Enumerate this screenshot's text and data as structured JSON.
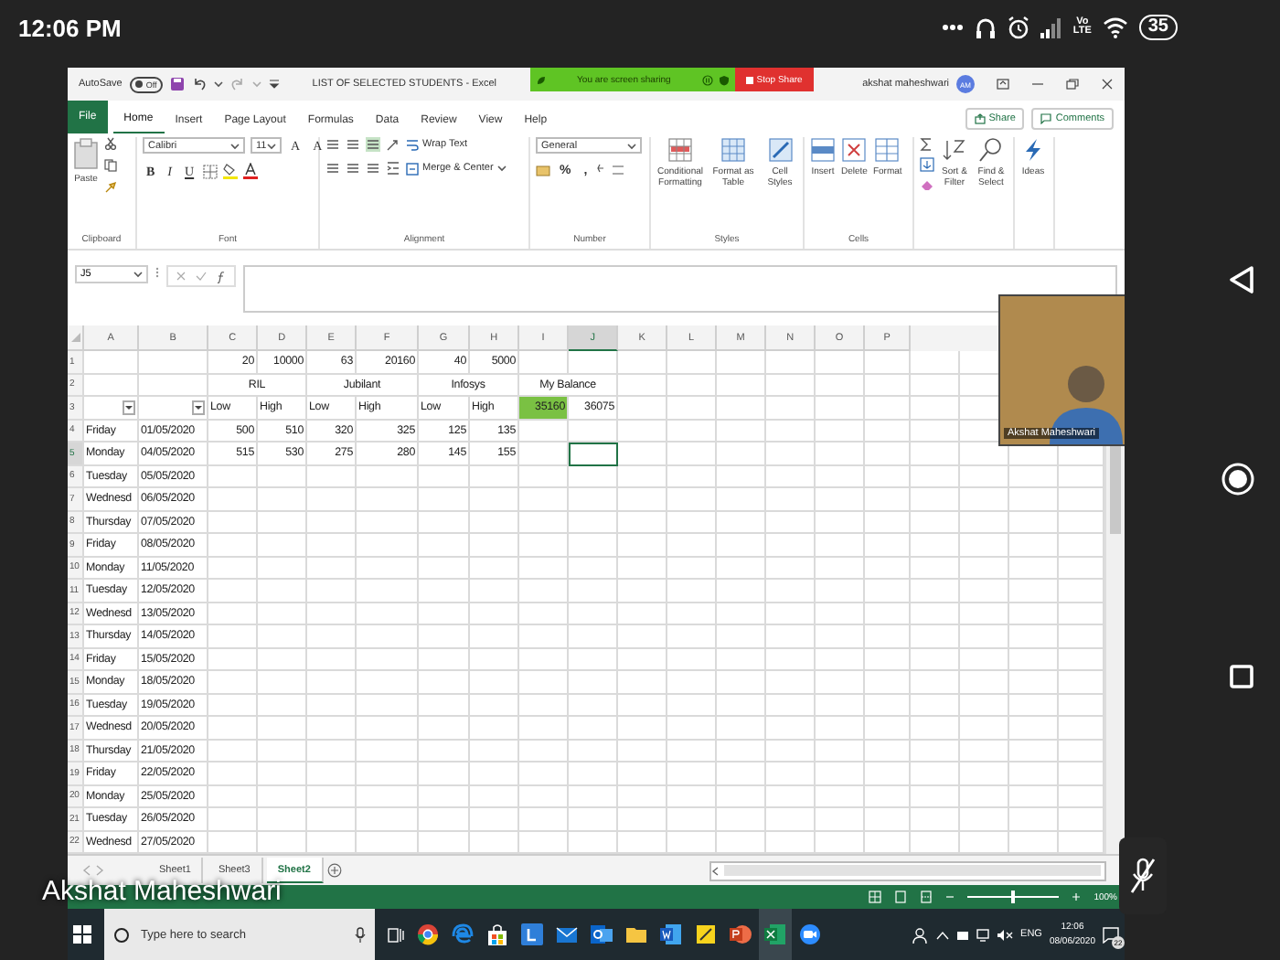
{
  "phone_status": {
    "time": "12:06 PM",
    "network": [
      "Vo",
      "LTE"
    ],
    "battery": "35"
  },
  "window": {
    "autosave_label": "AutoSave",
    "autosave_state": "Off",
    "autosave_on": false,
    "title": "LIST OF SELECTED STUDENTS  -  Excel",
    "user": "akshat maheshwari",
    "avatar": "AM"
  },
  "share_banner": {
    "message": "You are screen sharing",
    "stop": "Stop Share"
  },
  "ribbon_tabs": [
    {
      "label": "File",
      "kind": "file",
      "selected": false
    },
    {
      "label": "Home",
      "kind": "tab",
      "selected": true
    },
    {
      "label": "Insert",
      "kind": "tab",
      "selected": false
    },
    {
      "label": "Page Layout",
      "kind": "tab",
      "selected": false
    },
    {
      "label": "Formulas",
      "kind": "tab",
      "selected": false
    },
    {
      "label": "Data",
      "kind": "tab",
      "selected": false
    },
    {
      "label": "Review",
      "kind": "tab",
      "selected": false
    },
    {
      "label": "View",
      "kind": "tab",
      "selected": false
    },
    {
      "label": "Help",
      "kind": "tab",
      "selected": false
    }
  ],
  "ribbon_actions": {
    "share": "Share",
    "comments": "Comments"
  },
  "ribbon": [
    {
      "kind": "clipboard",
      "label": "Clipboard",
      "buttons": [
        "Paste"
      ]
    },
    {
      "kind": "font",
      "label": "Font",
      "font": "Calibri",
      "size": "11",
      "size_buttons": [
        "A",
        "A"
      ],
      "styles": [
        "B",
        "I",
        "U"
      ]
    },
    {
      "kind": "alignment",
      "label": "Alignment",
      "buttons": [
        "Wrap Text",
        "Merge & Center"
      ]
    },
    {
      "kind": "number",
      "label": "Number",
      "format": "General",
      "symbols": [
        "%",
        ","
      ]
    },
    {
      "kind": "styles",
      "label": "Styles",
      "buttons": [
        "Conditional Formatting",
        "Format as Table",
        "Cell Styles"
      ]
    },
    {
      "kind": "cells",
      "label": "Cells",
      "buttons": [
        "Insert",
        "Delete",
        "Format"
      ]
    },
    {
      "kind": "editing",
      "buttons": [
        "Sort & Filter",
        "Find & Select"
      ]
    },
    {
      "kind": "ideas",
      "buttons": [
        "Ideas"
      ]
    }
  ],
  "formula_bar": {
    "name_box": "J5"
  },
  "columns": [
    {
      "label": "A",
      "selected": false
    },
    {
      "label": "B",
      "selected": false
    },
    {
      "label": "C",
      "selected": false
    },
    {
      "label": "D",
      "selected": false
    },
    {
      "label": "E",
      "selected": false
    },
    {
      "label": "F",
      "selected": false
    },
    {
      "label": "G",
      "selected": false
    },
    {
      "label": "H",
      "selected": false
    },
    {
      "label": "I",
      "selected": false
    },
    {
      "label": "J",
      "selected": true
    },
    {
      "label": "K",
      "selected": false
    },
    {
      "label": "L",
      "selected": false
    },
    {
      "label": "M",
      "selected": false
    },
    {
      "label": "N",
      "selected": false
    },
    {
      "label": "O",
      "selected": false
    },
    {
      "label": "P",
      "selected": false
    }
  ],
  "rows": [
    {
      "number": "1",
      "selected": false,
      "cells": [
        {},
        {},
        {
          "kind": "number",
          "text": "20"
        },
        {
          "kind": "number",
          "text": "10000"
        },
        {
          "kind": "number",
          "text": "63"
        },
        {
          "kind": "number",
          "text": "20160"
        },
        {
          "kind": "number",
          "text": "40"
        },
        {
          "kind": "number",
          "text": "5000"
        }
      ]
    },
    {
      "number": "2",
      "selected": false,
      "cells": [
        {},
        {},
        {
          "kind": "merged",
          "text": "RIL"
        },
        {
          "kind": "merged",
          "text": "Jubilant"
        },
        {
          "kind": "merged",
          "text": "Infosys"
        },
        {
          "kind": "merged",
          "text": "My Balance"
        }
      ]
    },
    {
      "number": "3",
      "selected": false,
      "cells": [
        {
          "kind": "filter"
        },
        {
          "kind": "filter"
        },
        {
          "kind": "text",
          "text": "Low"
        },
        {
          "kind": "text",
          "text": "High"
        },
        {
          "kind": "text",
          "text": "Low"
        },
        {
          "kind": "text",
          "text": "High"
        },
        {
          "kind": "text",
          "text": "Low"
        },
        {
          "kind": "text",
          "text": "High"
        },
        {
          "kind": "number",
          "text": "35160",
          "highlighted": true
        },
        {
          "kind": "number",
          "text": "36075",
          "highlighted": false
        }
      ]
    },
    {
      "number": "4",
      "selected": false,
      "cells": [
        {
          "kind": "text",
          "text": "Friday"
        },
        {
          "kind": "text",
          "text": "01/05/2020"
        },
        {
          "kind": "number",
          "text": "500"
        },
        {
          "kind": "number",
          "text": "510"
        },
        {
          "kind": "number",
          "text": "320"
        },
        {
          "kind": "number",
          "text": "325"
        },
        {
          "kind": "number",
          "text": "125"
        },
        {
          "kind": "number",
          "text": "135"
        }
      ]
    },
    {
      "number": "5",
      "selected": true,
      "cells": [
        {
          "kind": "text",
          "text": "Monday"
        },
        {
          "kind": "text",
          "text": "04/05/2020"
        },
        {
          "kind": "number",
          "text": "515"
        },
        {
          "kind": "number",
          "text": "530"
        },
        {
          "kind": "number",
          "text": "275"
        },
        {
          "kind": "number",
          "text": "280"
        },
        {
          "kind": "number",
          "text": "145"
        },
        {
          "kind": "number",
          "text": "155"
        },
        {},
        {
          "kind": "active",
          "selected": true
        }
      ]
    },
    {
      "number": "6",
      "selected": false,
      "cells": [
        {
          "kind": "text",
          "text": "Tuesday"
        },
        {
          "kind": "text",
          "text": "05/05/2020"
        }
      ]
    },
    {
      "number": "7",
      "selected": false,
      "cells": [
        {
          "kind": "text",
          "text": "Wednesd"
        },
        {
          "kind": "text",
          "text": "06/05/2020"
        }
      ]
    },
    {
      "number": "8",
      "selected": false,
      "cells": [
        {
          "kind": "text",
          "text": "Thursday"
        },
        {
          "kind": "text",
          "text": "07/05/2020"
        }
      ]
    },
    {
      "number": "9",
      "selected": false,
      "cells": [
        {
          "kind": "text",
          "text": "Friday"
        },
        {
          "kind": "text",
          "text": "08/05/2020"
        }
      ]
    },
    {
      "number": "10",
      "selected": false,
      "cells": [
        {
          "kind": "text",
          "text": "Monday"
        },
        {
          "kind": "text",
          "text": "11/05/2020"
        }
      ]
    },
    {
      "number": "11",
      "selected": false,
      "cells": [
        {
          "kind": "text",
          "text": "Tuesday"
        },
        {
          "kind": "text",
          "text": "12/05/2020"
        }
      ]
    },
    {
      "number": "12",
      "selected": false,
      "cells": [
        {
          "kind": "text",
          "text": "Wednesd"
        },
        {
          "kind": "text",
          "text": "13/05/2020"
        }
      ]
    },
    {
      "number": "13",
      "selected": false,
      "cells": [
        {
          "kind": "text",
          "text": "Thursday"
        },
        {
          "kind": "text",
          "text": "14/05/2020"
        }
      ]
    },
    {
      "number": "14",
      "selected": false,
      "cells": [
        {
          "kind": "text",
          "text": "Friday"
        },
        {
          "kind": "text",
          "text": "15/05/2020"
        }
      ]
    },
    {
      "number": "15",
      "selected": false,
      "cells": [
        {
          "kind": "text",
          "text": "Monday"
        },
        {
          "kind": "text",
          "text": "18/05/2020"
        }
      ]
    },
    {
      "number": "16",
      "selected": false,
      "cells": [
        {
          "kind": "text",
          "text": "Tuesday"
        },
        {
          "kind": "text",
          "text": "19/05/2020"
        }
      ]
    },
    {
      "number": "17",
      "selected": false,
      "cells": [
        {
          "kind": "text",
          "text": "Wednesd"
        },
        {
          "kind": "text",
          "text": "20/05/2020"
        }
      ]
    },
    {
      "number": "18",
      "selected": false,
      "cells": [
        {
          "kind": "text",
          "text": "Thursday"
        },
        {
          "kind": "text",
          "text": "21/05/2020"
        }
      ]
    },
    {
      "number": "19",
      "selected": false,
      "cells": [
        {
          "kind": "text",
          "text": "Friday"
        },
        {
          "kind": "text",
          "text": "22/05/2020"
        }
      ]
    },
    {
      "number": "20",
      "selected": false,
      "cells": [
        {
          "kind": "text",
          "text": "Monday"
        },
        {
          "kind": "text",
          "text": "25/05/2020"
        }
      ]
    },
    {
      "number": "21",
      "selected": false,
      "cells": [
        {
          "kind": "text",
          "text": "Tuesday"
        },
        {
          "kind": "text",
          "text": "26/05/2020"
        }
      ]
    },
    {
      "number": "22",
      "selected": false,
      "cells": [
        {
          "kind": "text",
          "text": "Wednesd"
        },
        {
          "kind": "text",
          "text": "27/05/2020"
        }
      ]
    }
  ],
  "sheets": [
    {
      "label": "Sheet1",
      "selected": false
    },
    {
      "label": "Sheet3",
      "selected": false
    },
    {
      "label": "Sheet2",
      "selected": true
    }
  ],
  "zoom": {
    "level": 0.5,
    "reading": "100%"
  },
  "video": {
    "name": "Akshat Maheshwari"
  },
  "speaker_label": "Akshat Maheshwari",
  "mic": {
    "muted": true
  },
  "taskbar": {
    "search_placeholder": "Type here to search",
    "language": "ENG",
    "time": "12:06",
    "date": "08/06/2020",
    "notifications": "22"
  }
}
